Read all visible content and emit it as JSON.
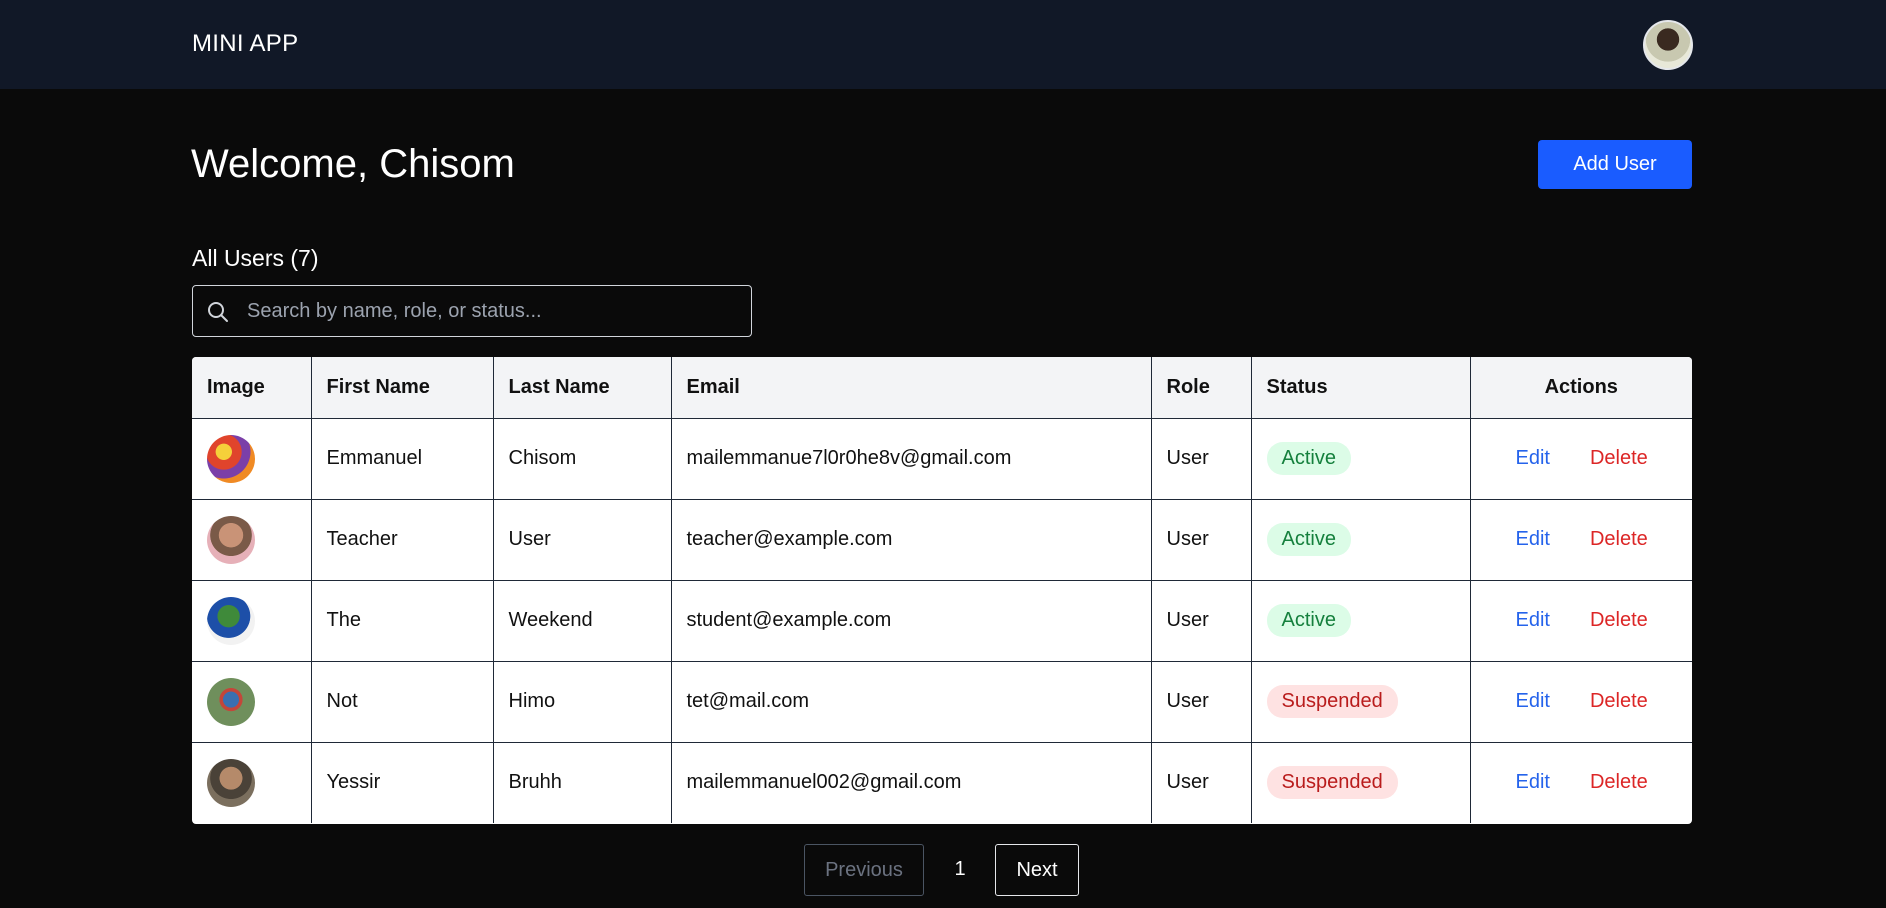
{
  "header": {
    "brand": "MINI APP"
  },
  "main": {
    "welcome": "Welcome, Chisom",
    "add_user_label": "Add User",
    "users_count_title": "All Users (7)"
  },
  "search": {
    "placeholder": "Search by name, role, or status..."
  },
  "table": {
    "headers": [
      "Image",
      "First Name",
      "Last Name",
      "Email",
      "Role",
      "Status",
      "Actions"
    ],
    "rows": [
      {
        "first_name": "Emmanuel",
        "last_name": "Chisom",
        "email": "mailemmanue7l0r0he8v@gmail.com",
        "role": "User",
        "status": "Active",
        "edit": "Edit",
        "delete": "Delete"
      },
      {
        "first_name": "Teacher",
        "last_name": "User",
        "email": "teacher@example.com",
        "role": "User",
        "status": "Active",
        "edit": "Edit",
        "delete": "Delete"
      },
      {
        "first_name": "The",
        "last_name": "Weekend",
        "email": "student@example.com",
        "role": "User",
        "status": "Active",
        "edit": "Edit",
        "delete": "Delete"
      },
      {
        "first_name": "Not",
        "last_name": "Himo",
        "email": "tet@mail.com",
        "role": "User",
        "status": "Suspended",
        "edit": "Edit",
        "delete": "Delete"
      },
      {
        "first_name": "Yessir",
        "last_name": "Bruhh",
        "email": "mailemmanuel002@gmail.com",
        "role": "User",
        "status": "Suspended",
        "edit": "Edit",
        "delete": "Delete"
      }
    ]
  },
  "pagination": {
    "previous": "Previous",
    "page": "1",
    "next": "Next"
  },
  "colors": {
    "accent": "#1a5cff",
    "navbar": "#111827",
    "active": "#15803d",
    "suspended": "#b91c1c",
    "edit": "#2563eb",
    "delete": "#dc2626"
  }
}
